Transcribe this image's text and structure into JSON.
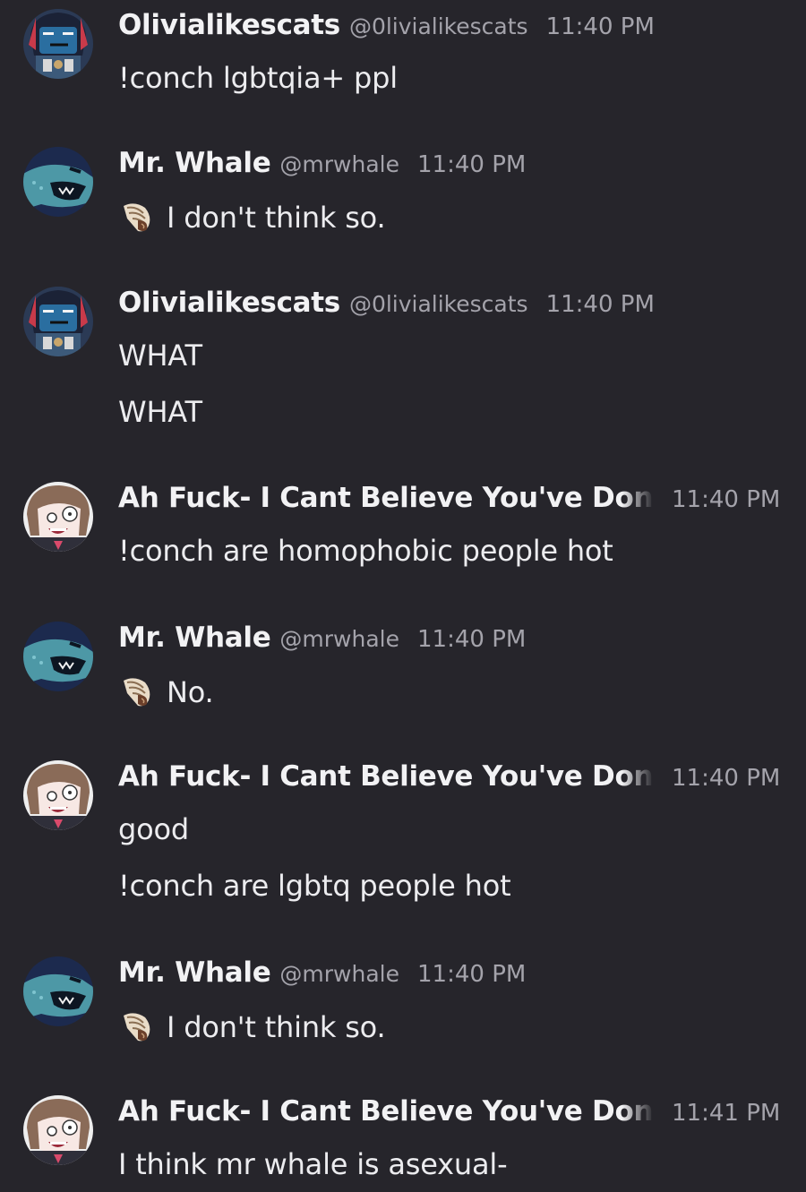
{
  "messages": [
    {
      "author": "Olivialikescats",
      "handle": "@0livialikescats",
      "time": "11:40 PM",
      "avatar": "olivia-avatar",
      "lines": [
        "!conch lgbtqia+ ppl"
      ]
    },
    {
      "author": "Mr. Whale",
      "handle": "@mrwhale",
      "time": "11:40 PM",
      "avatar": "whale-avatar",
      "lines": [
        "I don't think so."
      ],
      "conch_icon": "conch-shell-icon"
    },
    {
      "author": "Olivialikescats",
      "handle": "@0livialikescats",
      "time": "11:40 PM",
      "avatar": "olivia-avatar",
      "lines": [
        "WHAT",
        "WHAT"
      ]
    },
    {
      "author": "Ah Fuck- I Cant Believe You've Done",
      "time": "11:40 PM",
      "avatar": "anime-avatar",
      "lines": [
        "!conch are homophobic people hot"
      ]
    },
    {
      "author": "Mr. Whale",
      "handle": "@mrwhale",
      "time": "11:40 PM",
      "avatar": "whale-avatar",
      "lines": [
        "No."
      ],
      "conch_icon": "conch-shell-icon"
    },
    {
      "author": "Ah Fuck- I Cant Believe You've Done",
      "time": "11:40 PM",
      "avatar": "anime-avatar",
      "lines": [
        "good",
        "!conch are lgbtq people hot"
      ]
    },
    {
      "author": "Mr. Whale",
      "handle": "@mrwhale",
      "time": "11:40 PM",
      "avatar": "whale-avatar",
      "lines": [
        "I don't think so."
      ],
      "conch_icon": "conch-shell-icon"
    },
    {
      "author": "Ah Fuck- I Cant Believe You've Done",
      "time": "11:41 PM",
      "avatar": "anime-avatar",
      "lines": [
        "I think mr whale is asexual-"
      ]
    }
  ]
}
